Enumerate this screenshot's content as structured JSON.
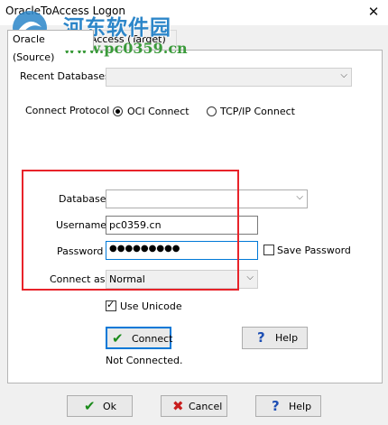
{
  "window": {
    "title": "OracleToAccess Logon",
    "close_glyph": "✕"
  },
  "watermark": {
    "site_name": "河东软件园",
    "url": "www.pc0359.cn"
  },
  "tabs": [
    {
      "label": "Oracle (Source)",
      "active": true
    },
    {
      "label": "Access (Target)",
      "active": false
    }
  ],
  "form": {
    "recent_databases_label": "Recent Databases",
    "recent_databases_value": "",
    "connect_protocol_label": "Connect Protocol",
    "protocols": [
      {
        "label": "OCI Connect",
        "selected": true
      },
      {
        "label": "TCP/IP Connect",
        "selected": false
      }
    ],
    "database_label": "Database",
    "database_value": "",
    "username_label": "Username",
    "username_value": "pc0359.cn",
    "password_label": "Password",
    "password_value": "●●●●●●●●●",
    "save_password_label": "Save Password",
    "save_password_checked": false,
    "connect_as_label": "Connect as",
    "connect_as_value": "Normal",
    "use_unicode_label": "Use Unicode",
    "use_unicode_checked": true,
    "connect_button_label": "Connect",
    "help_button_label": "Help",
    "status_text": "Not Connected."
  },
  "footer": {
    "ok_label": "Ok",
    "cancel_label": "Cancel",
    "help_label": "Help"
  },
  "colors": {
    "accent": "#0078d7",
    "highlight_box": "#e8232a",
    "check_green": "#1a8a1a",
    "cancel_red": "#c81e1e",
    "help_blue": "#1e4fb4"
  }
}
